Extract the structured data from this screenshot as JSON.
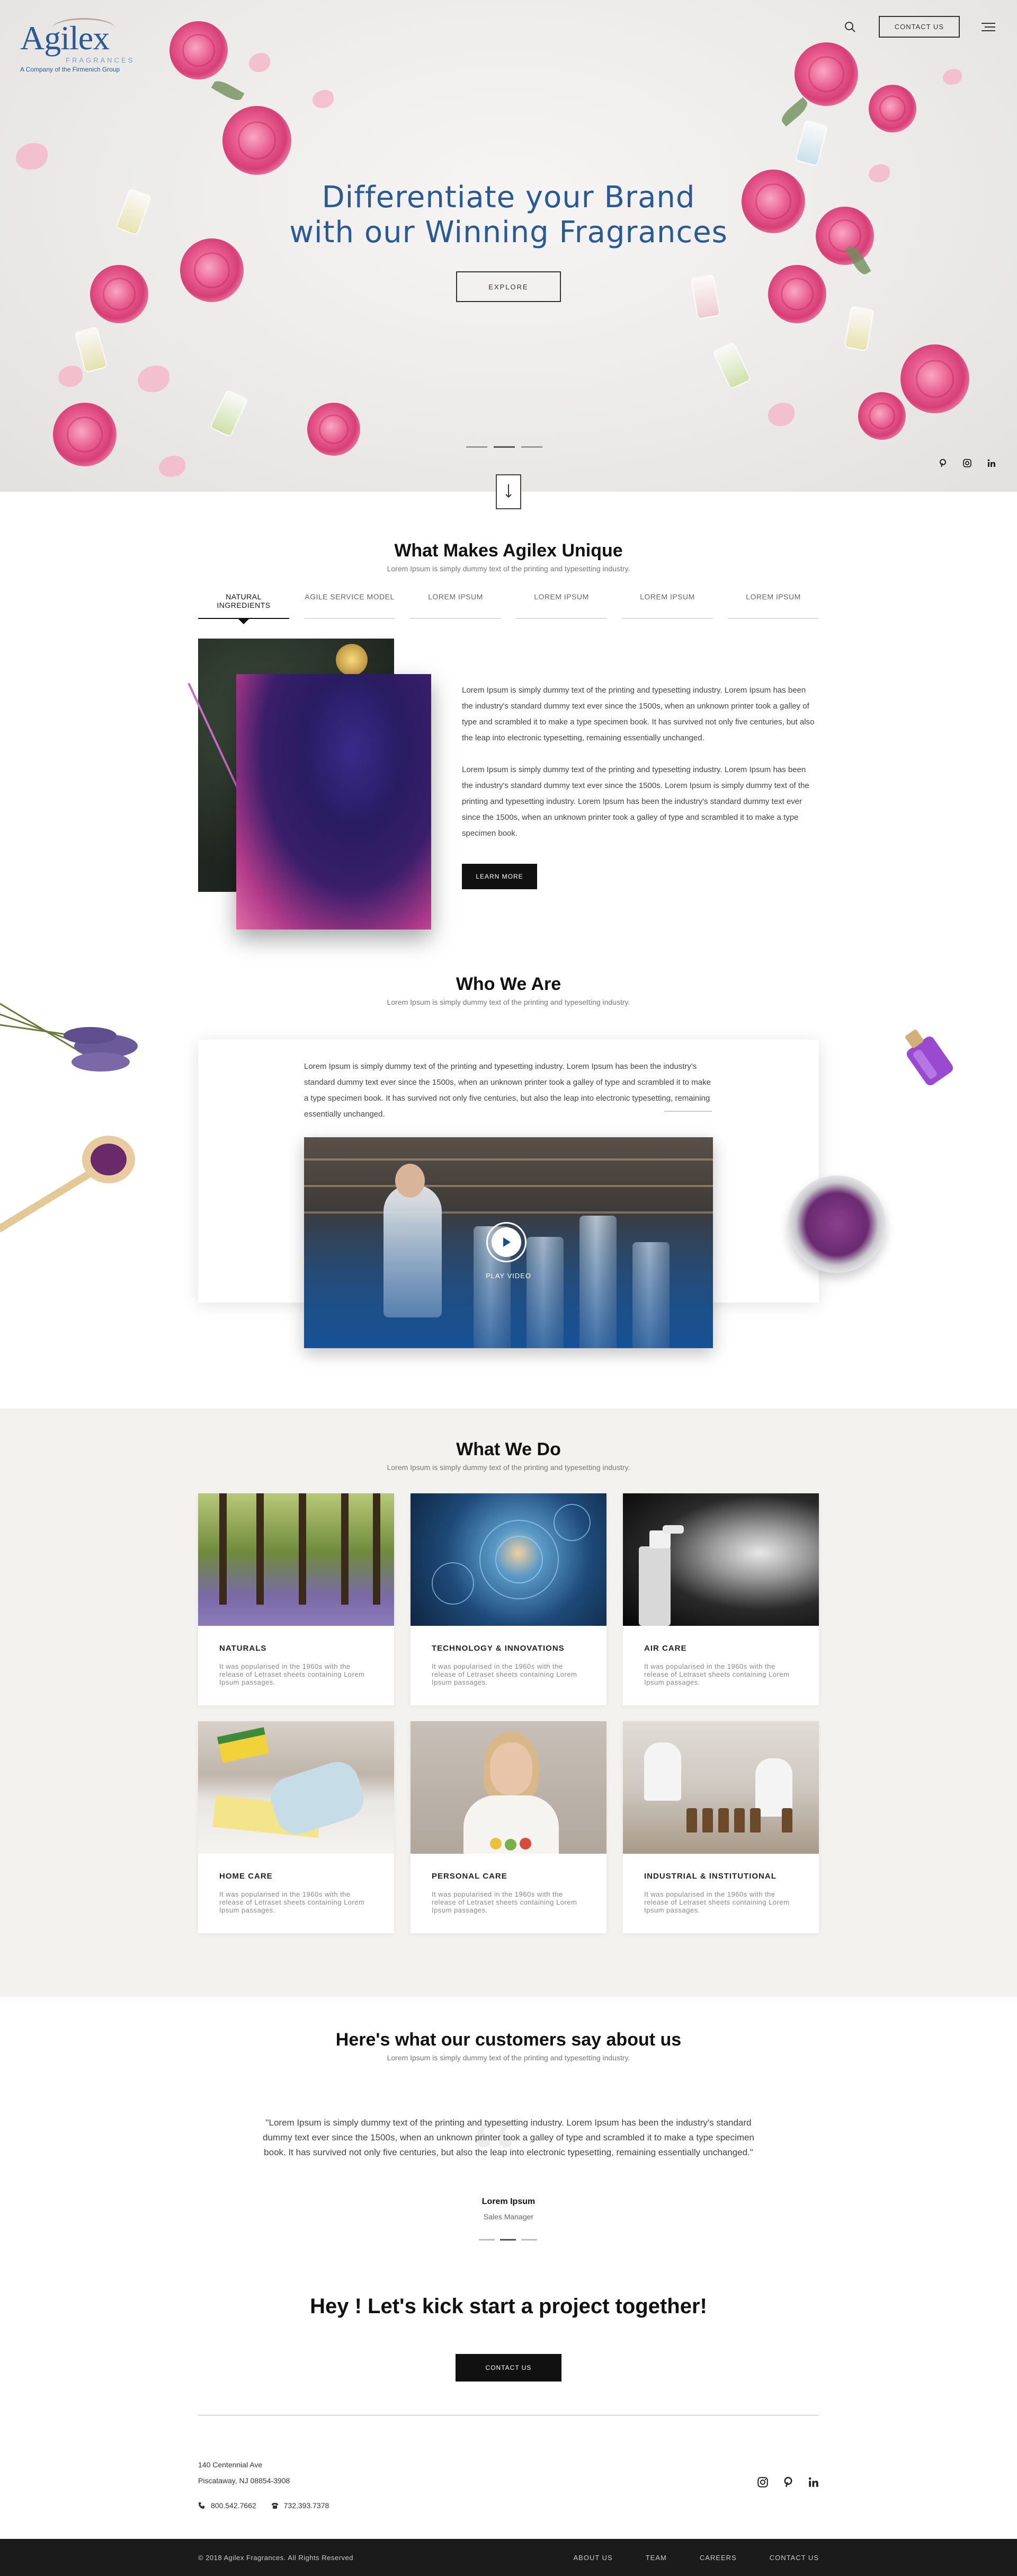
{
  "brand": {
    "name": "Agilex",
    "sub1": "FRAGRANCES",
    "sub2": "A Company of the Firmenich Group",
    "accent": "#2a5a95"
  },
  "header": {
    "search_icon": "search-icon",
    "contact_label": "CONTACT US",
    "menu_icon": "hamburger-menu-icon"
  },
  "hero": {
    "title_line1": "Differentiate your Brand",
    "title_line2": "with our Winning Fragrances",
    "explore_label": "EXPLORE",
    "social": [
      "pinterest-icon",
      "instagram-icon",
      "linkedin-icon"
    ]
  },
  "unique": {
    "title": "What Makes Agilex Unique",
    "subtitle": "Lorem Ipsum is simply dummy text of the printing and typesetting industry.",
    "tabs": [
      "NATURAL INGREDIENTS",
      "AGILE SERVICE MODEL",
      "LOREM IPSUM",
      "LOREM IPSUM",
      "LOREM IPSUM",
      "LOREM IPSUM"
    ],
    "para1": "Lorem Ipsum is simply dummy text of the printing and typesetting industry. Lorem Ipsum has been the industry's standard dummy text ever since the 1500s, when an unknown printer took a galley of type and scrambled it to make a type specimen book. It has survived not only five centuries, but also the leap into electronic typesetting, remaining essentially unchanged.",
    "para2": "Lorem Ipsum is simply dummy text of the printing and typesetting industry. Lorem Ipsum has been the industry's standard dummy text ever since the 1500s. Lorem Ipsum is simply dummy text of the printing and typesetting industry. Lorem Ipsum has been the industry's standard dummy text ever since the 1500s, when an unknown printer took a galley of type and scrambled it to make a type specimen book.",
    "learn_label": "LEARN MORE"
  },
  "who": {
    "title": "Who We Are",
    "subtitle": "Lorem Ipsum is simply dummy text of the printing and typesetting industry.",
    "text": "Lorem Ipsum is simply dummy text of the printing and typesetting industry. Lorem Ipsum has been the industry's standard dummy text ever since the 1500s, when an unknown printer took a galley of type and scrambled it to make a type specimen book. It has survived not only five centuries, but also the leap into electronic typesetting, remaining essentially unchanged.",
    "play_label": "PLAY VIDEO"
  },
  "services": {
    "title": "What We Do",
    "subtitle": "Lorem Ipsum is simply dummy text of the printing and typesetting industry.",
    "items": [
      {
        "name": "NATURALS",
        "desc": "It was popularised in the 1960s with the release of Letraset sheets containing Lorem Ipsum passages."
      },
      {
        "name": "TECHNOLOGY & INNOVATIONS",
        "desc": "It was popularised in the 1960s with the release of Letraset sheets containing Lorem Ipsum passages."
      },
      {
        "name": "AIR CARE",
        "desc": "It was popularised in the 1960s with the release of Letraset sheets containing Lorem Ipsum passages."
      },
      {
        "name": "HOME CARE",
        "desc": "It was popularised in the 1960s with the release of Letraset sheets containing Lorem Ipsum passages."
      },
      {
        "name": "PERSONAL CARE",
        "desc": "It was popularised in the 1960s with the release of Letraset sheets containing Lorem Ipsum passages."
      },
      {
        "name": "INDUSTRIAL & INSTITUTIONAL",
        "desc": "It was popularised in the 1960s with the release of Letraset sheets containing Lorem Ipsum passages."
      }
    ]
  },
  "testimonial": {
    "title": "Here's what our customers say about us",
    "subtitle": "Lorem Ipsum is simply dummy text of the printing and typesetting industry.",
    "quote": "\"Lorem Ipsum is simply dummy text of the printing and typesetting industry. Lorem Ipsum has been the industry's standard dummy text ever since the 1500s, when an unknown printer took a galley of type and scrambled it to make a type specimen book. It has survived not only five centuries, but also the leap into electronic typesetting, remaining essentially unchanged.\"",
    "name": "Lorem Ipsum",
    "role": "Sales Manager"
  },
  "cta": {
    "title": "Hey ! Let's kick start a project together!",
    "button_label": "CONTACT US"
  },
  "footer": {
    "address_line1": "140 Centennial Ave",
    "address_line2": "Piscataway, NJ 08854-3908",
    "phone1": "800.542.7662",
    "phone2": "732.393.7378",
    "social": [
      "instagram-icon",
      "pinterest-icon",
      "linkedin-icon"
    ],
    "copyright": "© 2018 Agilex Fragrances. All Rights Reserved",
    "links": [
      "ABOUT US",
      "TEAM",
      "CAREERS",
      "CONTACT US"
    ]
  }
}
